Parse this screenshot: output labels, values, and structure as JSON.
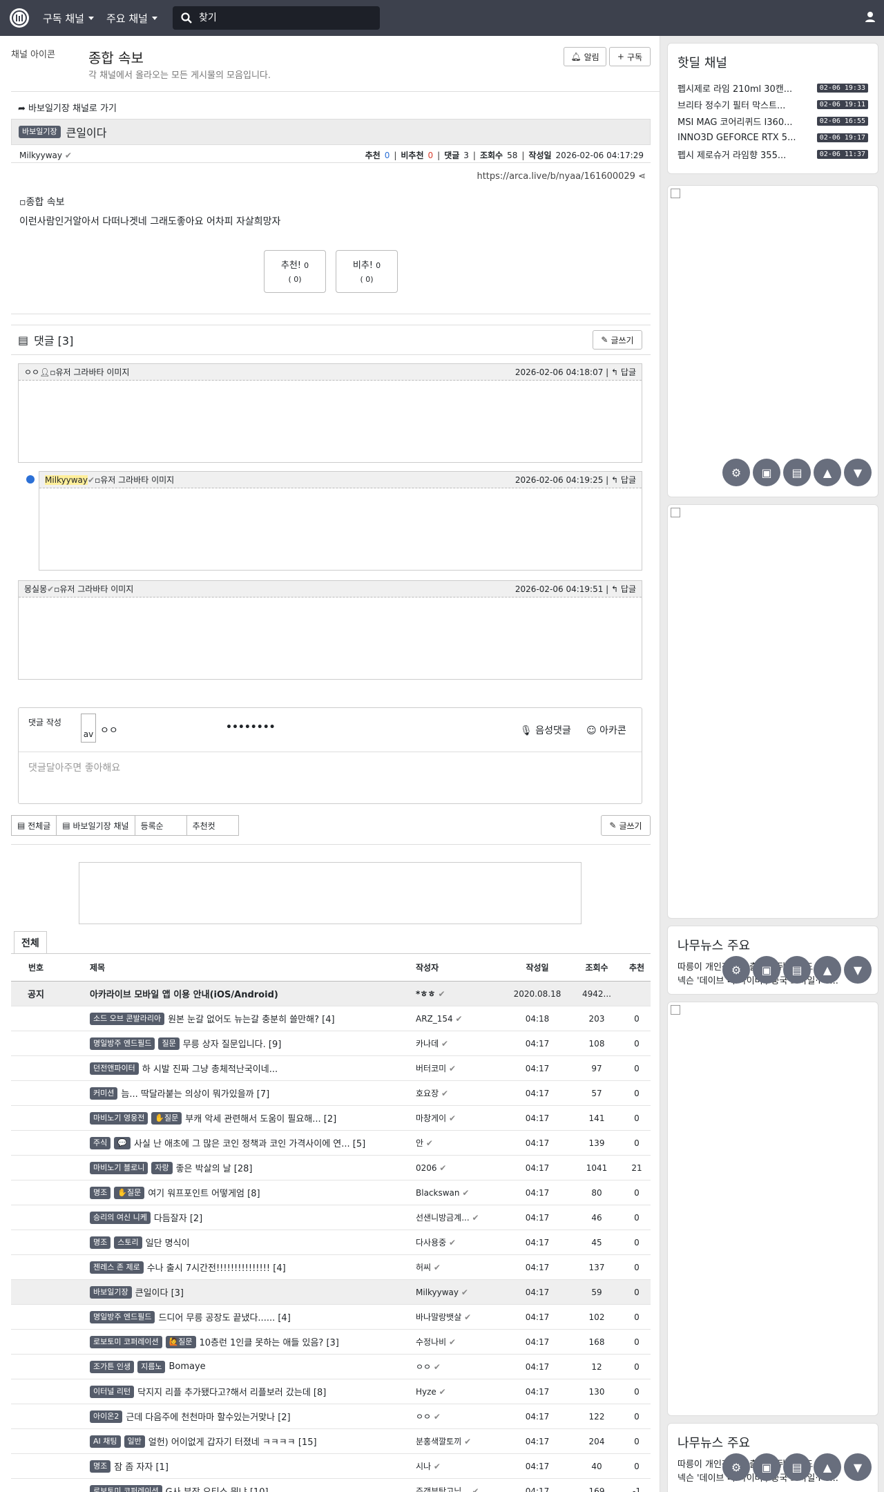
{
  "topbar": {
    "logo": "arca-logo",
    "menu1": "구독 채널",
    "menu2": "주요 채널",
    "search_placeholder": "찾기"
  },
  "channel": {
    "img_alt": "채널 아이콘",
    "title": "종합 속보",
    "desc": "각 채널에서 올라오는 모든 게시물의 모음입니다.",
    "alert_btn": "알림",
    "subscribe_btn": "구독"
  },
  "post": {
    "back": "바보일기장 채널로 가기",
    "badge": "바보일기장",
    "title": "큰일이다",
    "author": "Milkyyway",
    "rec_label": "추천",
    "rec": "0",
    "unrec_label": "비추천",
    "unrec": "0",
    "cmt_label": "댓글",
    "cmt": "3",
    "views_label": "조회수",
    "views": "58",
    "date_label": "작성일",
    "date": "2026-02-06 04:17:29",
    "url": "https://arca.live/b/nyaa/161600029",
    "img_alt": "종합 속보",
    "body": "이런사람인거알아서 다떠나겟네 그래도좋아요 어차피 자살희망자",
    "vote_up": "추천!",
    "vote_up_count": "0",
    "vote_up_sub": "( 0)",
    "vote_down": "비추!",
    "vote_down_count": "0",
    "vote_down_sub": "( 0)"
  },
  "comments": {
    "header": "댓글 [3]",
    "write_btn": "글쓰기",
    "reply": "답글",
    "items": [
      {
        "author": "ㅇㅇ",
        "img": "유저 그라바타 이미지",
        "date": "2026-02-06 04:18:07"
      },
      {
        "author": "Milkyyway",
        "img": "유저 그라바타 이미지",
        "date": "2026-02-06 04:19:25"
      },
      {
        "author": "몽실몽",
        "img": "유저 그라바타 이미지",
        "date": "2026-02-06 04:19:51"
      }
    ]
  },
  "compose": {
    "label": "댓글 작성",
    "avatar": "av",
    "name": "ㅇㅇ",
    "password": "••••••••",
    "voice": "음성댓글",
    "arcacon": "아카콘",
    "placeholder": "댓글달아주면 좋아해요"
  },
  "listtabs": {
    "all": "전체글",
    "channel": "바보일기장 채널",
    "sort": "등록순",
    "best": "추천컷",
    "write": "글쓰기"
  },
  "board": {
    "tab": "전체",
    "cols": {
      "no": "번호",
      "title": "제목",
      "author": "작성자",
      "date": "작성일",
      "views": "조회수",
      "rec": "추천"
    },
    "notice": {
      "no": "공지",
      "title": "아카라이브 모바일 앱 이용 안내(iOS/Android)",
      "author": "*ㅎㅎ",
      "date": "2020.08.18",
      "views": "4942...",
      "rec": ""
    },
    "rows": [
      {
        "badges": [
          "소드 오브 콘발라리아"
        ],
        "title": "원본 눈갈 없어도 뉴는갈 충분히 쓸만해? [4]",
        "author": "ARZ_154",
        "date": "04:18",
        "views": "203",
        "rec": "0"
      },
      {
        "badges": [
          "명일방주 엔드필드",
          "질문"
        ],
        "title": "무릉 상자 질문입니다. [9]",
        "author": "카나데",
        "date": "04:17",
        "views": "108",
        "rec": "0"
      },
      {
        "badges": [
          "던전앤파이터"
        ],
        "title": "하 시발 진짜 그냥 총체적난국이네...",
        "author": "버터코미",
        "date": "04:17",
        "views": "97",
        "rec": "0"
      },
      {
        "badges": [
          "커미션"
        ],
        "title": "늠... 딱달라붙는 의상이 뭐가있을까 [7]",
        "author": "호요장",
        "date": "04:17",
        "views": "57",
        "rec": "0"
      },
      {
        "badges": [
          "마비노기 영웅전",
          "✋질문"
        ],
        "title": "부캐 악세 관련해서 도움이 필요해... [2]",
        "author": "마창게이",
        "date": "04:17",
        "views": "141",
        "rec": "0"
      },
      {
        "badges": [
          "주식",
          "💬"
        ],
        "title": "사실 난 애초에 그 많은 코인 정책과 코인 가격사이에 연... [5]",
        "author": "안",
        "date": "04:17",
        "views": "139",
        "rec": "0"
      },
      {
        "badges": [
          "마비노기 블로니",
          "자랑"
        ],
        "title": "좋은 박살의 날 [28]",
        "author": "0206",
        "date": "04:17",
        "views": "1041",
        "rec": "21"
      },
      {
        "badges": [
          "명조",
          "✋질문"
        ],
        "title": "여기 워프포인트 어떻게엄 [8]",
        "author": "Blackswan",
        "date": "04:17",
        "views": "80",
        "rec": "0"
      },
      {
        "badges": [
          "승리의 여신 니케"
        ],
        "title": "다듬잘자 [2]",
        "author": "선샌니방금계...",
        "date": "04:17",
        "views": "46",
        "rec": "0"
      },
      {
        "badges": [
          "명조",
          "스토리"
        ],
        "title": "일단 명식이",
        "author": "다사용중",
        "date": "04:17",
        "views": "45",
        "rec": "0"
      },
      {
        "badges": [
          "젠레스 존 제로"
        ],
        "title": "수나 출시 7시간전!!!!!!!!!!!!!!! [4]",
        "author": "허씨",
        "date": "04:17",
        "views": "137",
        "rec": "0"
      },
      {
        "badges": [
          "바보일기장"
        ],
        "title": "큰일이다 [3]",
        "author": "Milkyyway",
        "date": "04:17",
        "views": "59",
        "rec": "0",
        "hl": true
      },
      {
        "badges": [
          "명일방주 엔드필드"
        ],
        "title": "드디어 무릉 공장도 끝냈다...... [4]",
        "author": "바나말랑뱃살",
        "date": "04:17",
        "views": "102",
        "rec": "0"
      },
      {
        "badges": [
          "로보토미 코퍼레이션",
          "🙋질문"
        ],
        "title": "10층런 1인클 못하는 애들 있음? [3]",
        "author": "수정나비",
        "date": "04:17",
        "views": "168",
        "rec": "0"
      },
      {
        "badges": [
          "조가튼 인생",
          "지름노"
        ],
        "title": "Bomaye",
        "author": "ㅇㅇ",
        "date": "04:17",
        "views": "12",
        "rec": "0"
      },
      {
        "badges": [
          "이터널 리턴"
        ],
        "title": "닥지지 리플 추가됐다고?해서 리플보러 갔는데 [8]",
        "author": "Hyze",
        "date": "04:17",
        "views": "130",
        "rec": "0"
      },
      {
        "badges": [
          "아이온2"
        ],
        "title": "근데 다음주에 천천마마 할수있는거맞나 [2]",
        "author": "ㅇㅇ",
        "date": "04:17",
        "views": "122",
        "rec": "0"
      },
      {
        "badges": [
          "AI 채팅",
          "일반"
        ],
        "title": "얼헌) 어이없게 갑자기 터졌네 ㅋㅋㅋㅋ [15]",
        "author": "분홍색깔토끼",
        "date": "04:17",
        "views": "204",
        "rec": "0"
      },
      {
        "badges": [
          "명조"
        ],
        "title": "잠 좀 자자 [1]",
        "author": "시나",
        "date": "04:17",
        "views": "40",
        "rec": "0"
      },
      {
        "badges": [
          "로보토미 코퍼레이션"
        ],
        "title": "G사 부장 오티스 뭐냐 [10]",
        "author": "주갱부탁고님...",
        "date": "04:17",
        "views": "169",
        "rec": "-1"
      }
    ]
  },
  "hotdeal": {
    "title": "핫딜 채널",
    "items": [
      {
        "text": "펩시제로 라임 210ml 30캔...",
        "date": "02-06 19:33"
      },
      {
        "text": "브리타 정수기 필터 막스트...",
        "date": "02-06 19:11"
      },
      {
        "text": "MSI MAG 코어리퀴드 I360...",
        "date": "02-06 16:55"
      },
      {
        "text": "INNO3D GEFORCE RTX 5...",
        "date": "02-06 19:17"
      },
      {
        "text": "펩시 제로슈거 라임향 355...",
        "date": "02-06 11:37"
      }
    ]
  },
  "news": {
    "title": "나무뉴스 주요",
    "line1": "따릉이 개인정보 유출 2년 뒤 알고도 방...",
    "line2": "넥슨 '데이브 더 다이버', 중국 모바일·PC..."
  },
  "colors": {
    "topbar": "#3d414d",
    "badge": "#555c6a",
    "accent": "#2c70d6"
  }
}
